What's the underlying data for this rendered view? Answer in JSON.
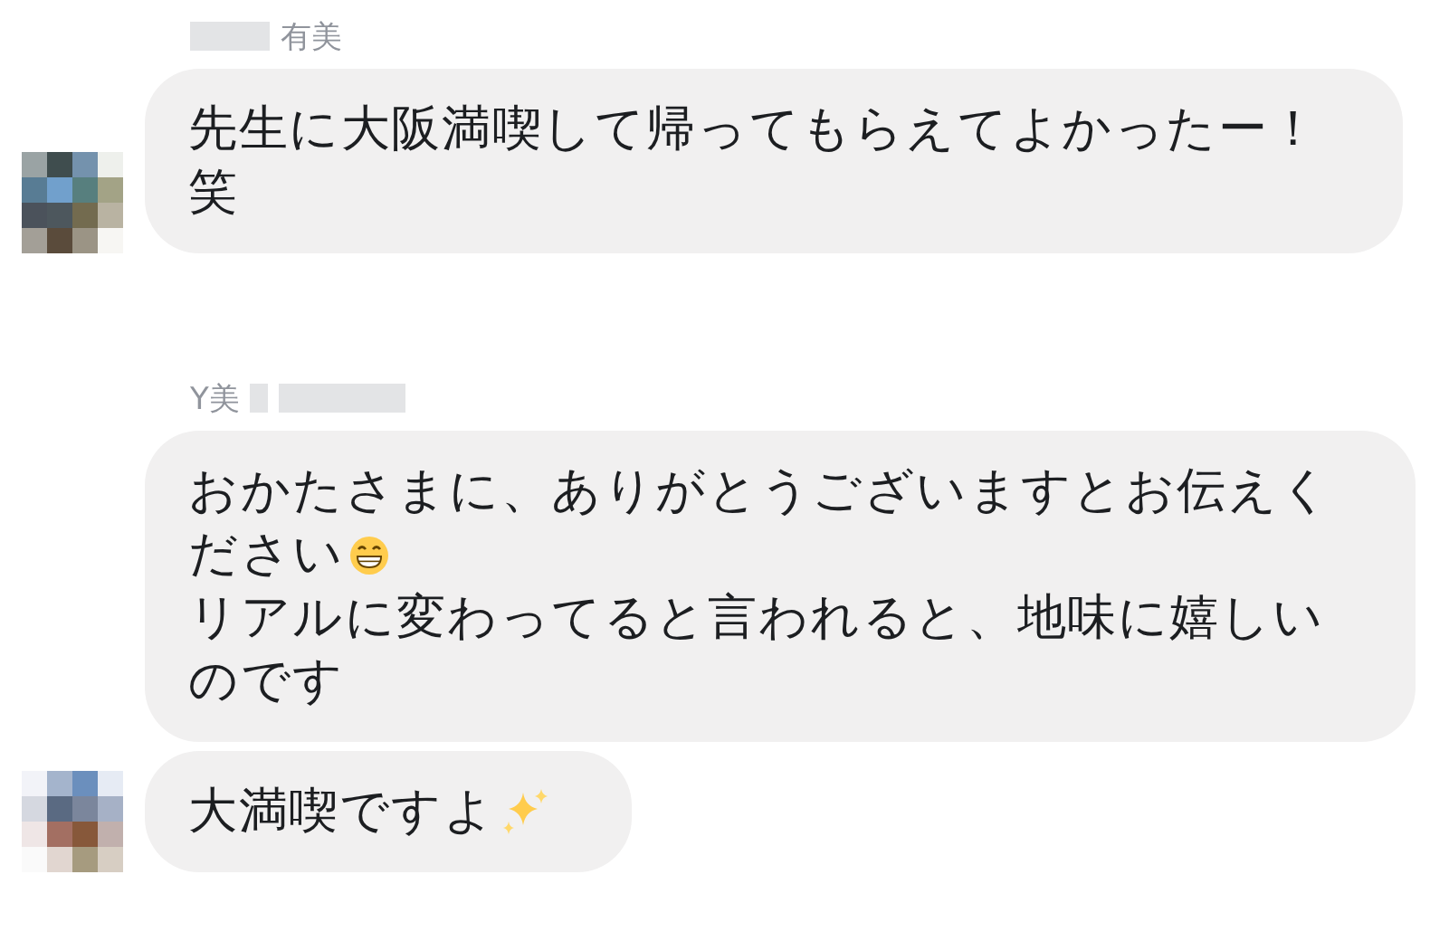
{
  "groups": [
    {
      "sender": {
        "visible_name": "有美",
        "redacted_before": true,
        "redacted_after": false
      },
      "messages": [
        {
          "avatar": true,
          "lines": [
            [
              {
                "kind": "text",
                "text": "先生に大阪満喫して帰ってもらえてよかったー！"
              }
            ],
            [
              {
                "kind": "text",
                "text": "笑"
              }
            ]
          ]
        }
      ]
    },
    {
      "sender": {
        "visible_name": "Y美",
        "redacted_before": false,
        "redacted_after": true
      },
      "messages": [
        {
          "avatar": false,
          "lines": [
            [
              {
                "kind": "text",
                "text": "おかたさまに、ありがとうございますとお伝えく"
              }
            ],
            [
              {
                "kind": "text",
                "text": "ださい"
              },
              {
                "kind": "grin"
              }
            ],
            [
              {
                "kind": "text",
                "text": "リアルに変わってると言われると、地味に嬉しい"
              }
            ],
            [
              {
                "kind": "text",
                "text": "のです"
              }
            ]
          ]
        },
        {
          "avatar": true,
          "lines": [
            [
              {
                "kind": "text",
                "text": "大満喫ですよ"
              },
              {
                "kind": "sparkles"
              }
            ]
          ]
        }
      ]
    }
  ]
}
